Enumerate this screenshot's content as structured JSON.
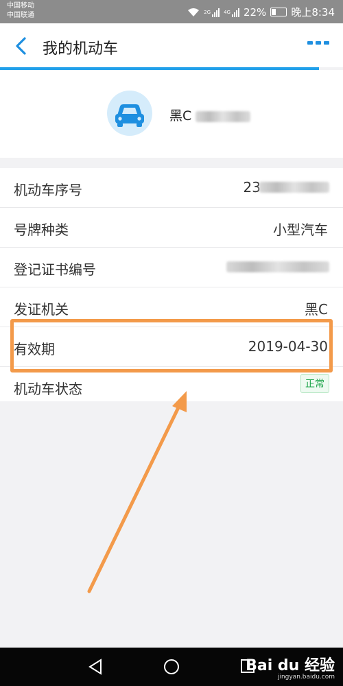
{
  "status_bar": {
    "carrier_1": "中国移动",
    "carrier_2": "中国联通",
    "network_1": "2G",
    "network_2": "4G",
    "battery_percent": "22%",
    "time": "晚上8:34"
  },
  "nav": {
    "title": "我的机动车"
  },
  "progress": {
    "fraction": 0.93
  },
  "vehicle": {
    "plate_prefix": "黑C"
  },
  "details": [
    {
      "label": "机动车序号",
      "value": "23"
    },
    {
      "label": "号牌种类",
      "value": "小型汽车"
    },
    {
      "label": "登记证书编号",
      "value": ""
    },
    {
      "label": "发证机关",
      "value": "黑C"
    },
    {
      "label": "有效期",
      "value": "2019-04-30"
    },
    {
      "label": "机动车状态",
      "value": "正常"
    }
  ],
  "watermark": {
    "brand": "Bai du 经验",
    "url": "jingyan.baidu.com"
  },
  "colors": {
    "accent": "#21a0ea",
    "highlight": "#f39a4a",
    "status_ok": "#1ea54b"
  }
}
